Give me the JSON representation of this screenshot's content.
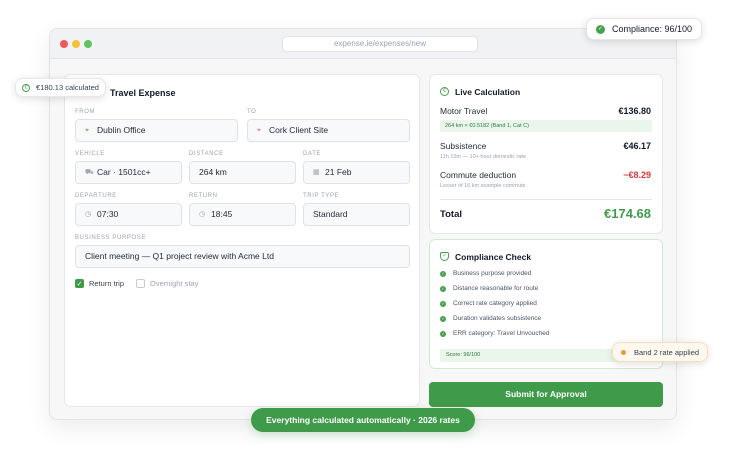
{
  "browser": {
    "url": "expense.ie/expenses/new"
  },
  "form": {
    "title": "Travel Expense",
    "from": {
      "label": "FROM",
      "value": "Dublin Office"
    },
    "to": {
      "label": "TO",
      "value": "Cork Client Site"
    },
    "vehicle": {
      "label": "VEHICLE",
      "value": "Car · 1501cc+"
    },
    "distance": {
      "label": "DISTANCE",
      "value": "264 km"
    },
    "date": {
      "label": "DATE",
      "value": "21 Feb"
    },
    "departure": {
      "label": "DEPARTURE",
      "value": "07:30"
    },
    "return_time": {
      "label": "RETURN",
      "value": "18:45"
    },
    "trip_type": {
      "label": "TRIP TYPE",
      "value": "Standard"
    },
    "purpose": {
      "label": "BUSINESS PURPOSE",
      "value": "Client meeting — Q1 project review with Acme Ltd"
    },
    "return_trip": {
      "label": "Return trip",
      "checked": true
    },
    "overnight": {
      "label": "Overnight stay",
      "checked": false
    }
  },
  "calc": {
    "title": "Live Calculation",
    "motor": {
      "label": "Motor Travel",
      "value": "€136.80",
      "detail": "264 km × €0.5182 (Band 1, Cat C)"
    },
    "subsistence": {
      "label": "Subsistence",
      "value": "€46.17",
      "detail": "11h 15m — 10+ hour domestic rate"
    },
    "commute": {
      "label": "Commute deduction",
      "value": "−€8.29",
      "detail": "Lesser of 16 km example commute"
    },
    "total": {
      "label": "Total",
      "value": "€174.68"
    }
  },
  "compliance": {
    "title": "Compliance Check",
    "checks": [
      "Business purpose provided",
      "Distance reasonable for route",
      "Correct rate category applied",
      "Duration validates subsistence",
      "ERR category: Travel Unvouched"
    ],
    "score": "Score: 96/100"
  },
  "submit_label": "Submit for Approval",
  "chips": {
    "calculated": "€180.13 calculated",
    "compliance": "Compliance: 96/100",
    "band": "Band 2 rate applied"
  },
  "banner": "Everything calculated automatically · 2026 rates",
  "colors": {
    "accent": "#3f9b4a",
    "negative": "#d73a3a",
    "warning": "#ef9a2f"
  },
  "icons": {
    "from": "map-pin-icon",
    "to": "map-pin-icon",
    "vehicle": "car-icon",
    "date": "calendar-icon",
    "time": "clock-icon",
    "calc": "euro-circle-icon",
    "compliance": "shield-icon"
  }
}
